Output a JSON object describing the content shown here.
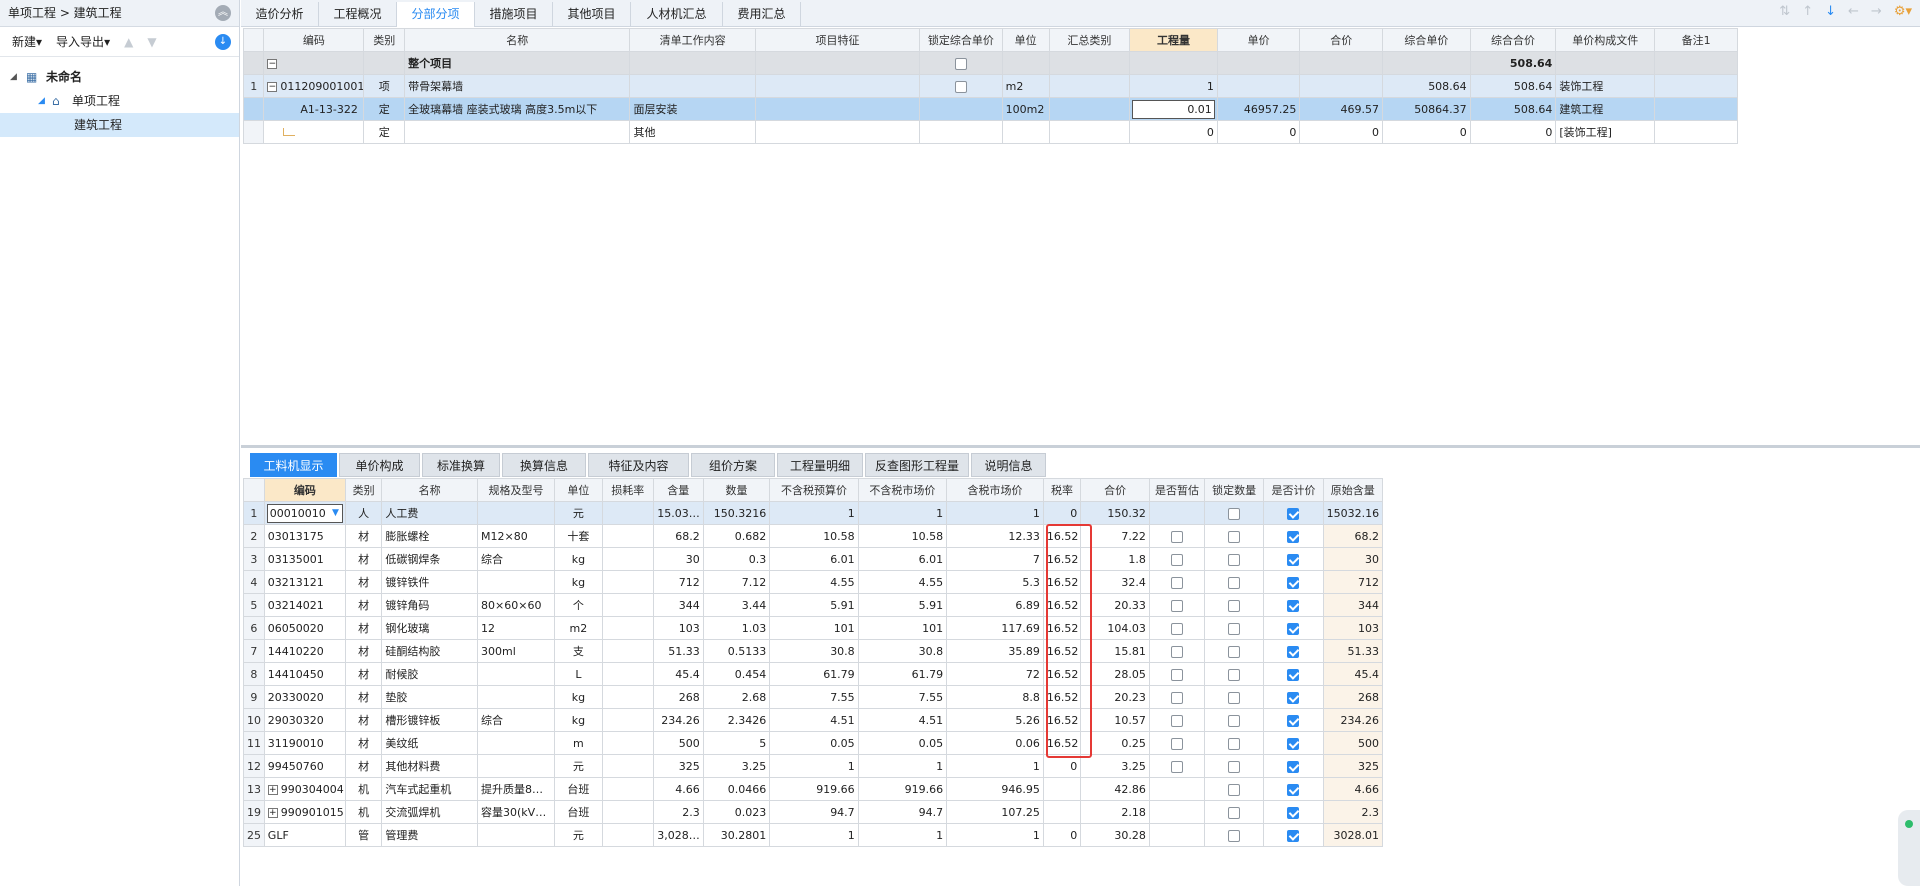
{
  "breadcrumb": "单项工程 > 建筑工程",
  "left_toolbar": {
    "new_label": "新建",
    "import_export_label": "导入导出"
  },
  "tree": {
    "root": "未命名",
    "child": "单项工程",
    "leaf": "建筑工程"
  },
  "top_tabs": [
    "造价分析",
    "工程概况",
    "分部分项",
    "措施项目",
    "其他项目",
    "人材机汇总",
    "费用汇总"
  ],
  "top_active_tab": "分部分项",
  "upper_table": {
    "headers": [
      "编码",
      "类别",
      "名称",
      "清单工作内容",
      "项目特征",
      "锁定综合单价",
      "单位",
      "汇总类别",
      "工程量",
      "单价",
      "合价",
      "综合单价",
      "综合合价",
      "单价构成文件",
      "备注1"
    ],
    "rows": [
      {
        "rownum": "",
        "code": "",
        "type": "",
        "name": "整个项目",
        "content": "",
        "feature": "",
        "unit": "",
        "summary": "",
        "qty": "",
        "price": "",
        "total": "",
        "cprice": "",
        "ctotal": "508.64",
        "file": "",
        "note": ""
      },
      {
        "rownum": "1",
        "code": "011209001001",
        "type": "项",
        "name": "带骨架幕墙",
        "content": "",
        "feature": "",
        "unit": "m2",
        "summary": "",
        "qty": "1",
        "price": "",
        "total": "",
        "cprice": "508.64",
        "ctotal": "508.64",
        "file": "装饰工程",
        "note": ""
      },
      {
        "rownum": "",
        "code": "A1-13-322",
        "type": "定",
        "name": "全玻璃幕墙 座装式玻璃 高度3.5m以下",
        "content": "面层安装",
        "feature": "",
        "unit": "100m2",
        "summary": "",
        "qty": "0.01",
        "price": "46957.25",
        "total": "469.57",
        "cprice": "50864.37",
        "ctotal": "508.64",
        "file": "建筑工程",
        "note": ""
      },
      {
        "rownum": "",
        "code": "",
        "type": "定",
        "name": "",
        "content": "其他",
        "feature": "",
        "unit": "",
        "summary": "",
        "qty": "0",
        "price": "0",
        "total": "0",
        "cprice": "0",
        "ctotal": "0",
        "file": "[装饰工程]",
        "note": ""
      }
    ]
  },
  "bottom_tabs": [
    "工料机显示",
    "单价构成",
    "标准换算",
    "换算信息",
    "特征及内容",
    "组价方案",
    "工程量明细",
    "反查图形工程量",
    "说明信息"
  ],
  "bottom_active_tab": "工料机显示",
  "lower_table": {
    "headers": [
      "编码",
      "类别",
      "名称",
      "规格及型号",
      "单位",
      "损耗率",
      "含量",
      "数量",
      "不含税预算价",
      "不含税市场价",
      "含税市场价",
      "税率",
      "合价",
      "是否暂估",
      "锁定数量",
      "是否计价",
      "原始含量"
    ],
    "rows": [
      {
        "n": "1",
        "code": "00010010",
        "type": "人",
        "name": "人工费",
        "spec": "",
        "unit": "元",
        "loss": "",
        "content": "15.03…",
        "qty": "150.3216",
        "p1": "1",
        "p2": "1",
        "p3": "1",
        "tax": "0",
        "total": "150.32",
        "est": "none",
        "lock": false,
        "calc": true,
        "orig": "15032.16"
      },
      {
        "n": "2",
        "code": "03013175",
        "type": "材",
        "name": "膨胀螺栓",
        "spec": "M12×80",
        "unit": "十套",
        "loss": "",
        "content": "68.2",
        "qty": "0.682",
        "p1": "10.58",
        "p2": "10.58",
        "p3": "12.33",
        "tax": "16.52",
        "total": "7.22",
        "est": "off",
        "lock": false,
        "calc": true,
        "orig": "68.2"
      },
      {
        "n": "3",
        "code": "03135001",
        "type": "材",
        "name": "低碳钢焊条",
        "spec": "综合",
        "unit": "kg",
        "loss": "",
        "content": "30",
        "qty": "0.3",
        "p1": "6.01",
        "p2": "6.01",
        "p3": "7",
        "tax": "16.52",
        "total": "1.8",
        "est": "off",
        "lock": false,
        "calc": true,
        "orig": "30"
      },
      {
        "n": "4",
        "code": "03213121",
        "type": "材",
        "name": "镀锌铁件",
        "spec": "",
        "unit": "kg",
        "loss": "",
        "content": "712",
        "qty": "7.12",
        "p1": "4.55",
        "p2": "4.55",
        "p3": "5.3",
        "tax": "16.52",
        "total": "32.4",
        "est": "off",
        "lock": false,
        "calc": true,
        "orig": "712"
      },
      {
        "n": "5",
        "code": "03214021",
        "type": "材",
        "name": "镀锌角码",
        "spec": "80×60×60",
        "unit": "个",
        "loss": "",
        "content": "344",
        "qty": "3.44",
        "p1": "5.91",
        "p2": "5.91",
        "p3": "6.89",
        "tax": "16.52",
        "total": "20.33",
        "est": "off",
        "lock": false,
        "calc": true,
        "orig": "344"
      },
      {
        "n": "6",
        "code": "06050020",
        "type": "材",
        "name": "钢化玻璃",
        "spec": "12",
        "unit": "m2",
        "loss": "",
        "content": "103",
        "qty": "1.03",
        "p1": "101",
        "p2": "101",
        "p3": "117.69",
        "tax": "16.52",
        "total": "104.03",
        "est": "off",
        "lock": false,
        "calc": true,
        "orig": "103"
      },
      {
        "n": "7",
        "code": "14410220",
        "type": "材",
        "name": "硅酮结构胶",
        "spec": "300ml",
        "unit": "支",
        "loss": "",
        "content": "51.33",
        "qty": "0.5133",
        "p1": "30.8",
        "p2": "30.8",
        "p3": "35.89",
        "tax": "16.52",
        "total": "15.81",
        "est": "off",
        "lock": false,
        "calc": true,
        "orig": "51.33"
      },
      {
        "n": "8",
        "code": "14410450",
        "type": "材",
        "name": "耐候胶",
        "spec": "",
        "unit": "L",
        "loss": "",
        "content": "45.4",
        "qty": "0.454",
        "p1": "61.79",
        "p2": "61.79",
        "p3": "72",
        "tax": "16.52",
        "total": "28.05",
        "est": "off",
        "lock": false,
        "calc": true,
        "orig": "45.4"
      },
      {
        "n": "9",
        "code": "20330020",
        "type": "材",
        "name": "垫胶",
        "spec": "",
        "unit": "kg",
        "loss": "",
        "content": "268",
        "qty": "2.68",
        "p1": "7.55",
        "p2": "7.55",
        "p3": "8.8",
        "tax": "16.52",
        "total": "20.23",
        "est": "off",
        "lock": false,
        "calc": true,
        "orig": "268"
      },
      {
        "n": "10",
        "code": "29030320",
        "type": "材",
        "name": "槽形镀锌板",
        "spec": "综合",
        "unit": "kg",
        "loss": "",
        "content": "234.26",
        "qty": "2.3426",
        "p1": "4.51",
        "p2": "4.51",
        "p3": "5.26",
        "tax": "16.52",
        "total": "10.57",
        "est": "off",
        "lock": false,
        "calc": true,
        "orig": "234.26"
      },
      {
        "n": "11",
        "code": "31190010",
        "type": "材",
        "name": "美纹纸",
        "spec": "",
        "unit": "m",
        "loss": "",
        "content": "500",
        "qty": "5",
        "p1": "0.05",
        "p2": "0.05",
        "p3": "0.06",
        "tax": "16.52",
        "total": "0.25",
        "est": "off",
        "lock": false,
        "calc": true,
        "orig": "500"
      },
      {
        "n": "12",
        "code": "99450760",
        "type": "材",
        "name": "其他材料费",
        "spec": "",
        "unit": "元",
        "loss": "",
        "content": "325",
        "qty": "3.25",
        "p1": "1",
        "p2": "1",
        "p3": "1",
        "tax": "0",
        "total": "3.25",
        "est": "off",
        "lock": false,
        "calc": true,
        "orig": "325"
      },
      {
        "n": "13",
        "code": "990304004",
        "type": "机",
        "name": "汽车式起重机",
        "spec": "提升质量8…",
        "unit": "台班",
        "loss": "",
        "content": "4.66",
        "qty": "0.0466",
        "p1": "919.66",
        "p2": "919.66",
        "p3": "946.95",
        "tax": "",
        "total": "42.86",
        "est": "none",
        "lock": false,
        "calc": true,
        "orig": "4.66",
        "expand": true
      },
      {
        "n": "19",
        "code": "990901015",
        "type": "机",
        "name": "交流弧焊机",
        "spec": "容量30(kV…",
        "unit": "台班",
        "loss": "",
        "content": "2.3",
        "qty": "0.023",
        "p1": "94.7",
        "p2": "94.7",
        "p3": "107.25",
        "tax": "",
        "total": "2.18",
        "est": "none",
        "lock": false,
        "calc": true,
        "orig": "2.3",
        "expand": true
      },
      {
        "n": "25",
        "code": "GLF",
        "type": "管",
        "name": "管理费",
        "spec": "",
        "unit": "元",
        "loss": "",
        "content": "3,028…",
        "qty": "30.2801",
        "p1": "1",
        "p2": "1",
        "p3": "1",
        "tax": "0",
        "total": "30.28",
        "est": "none",
        "lock": false,
        "calc": true,
        "orig": "3028.01"
      }
    ]
  },
  "colors": {
    "accent": "#2a8bf2",
    "highlight_border": "#e53935"
  }
}
